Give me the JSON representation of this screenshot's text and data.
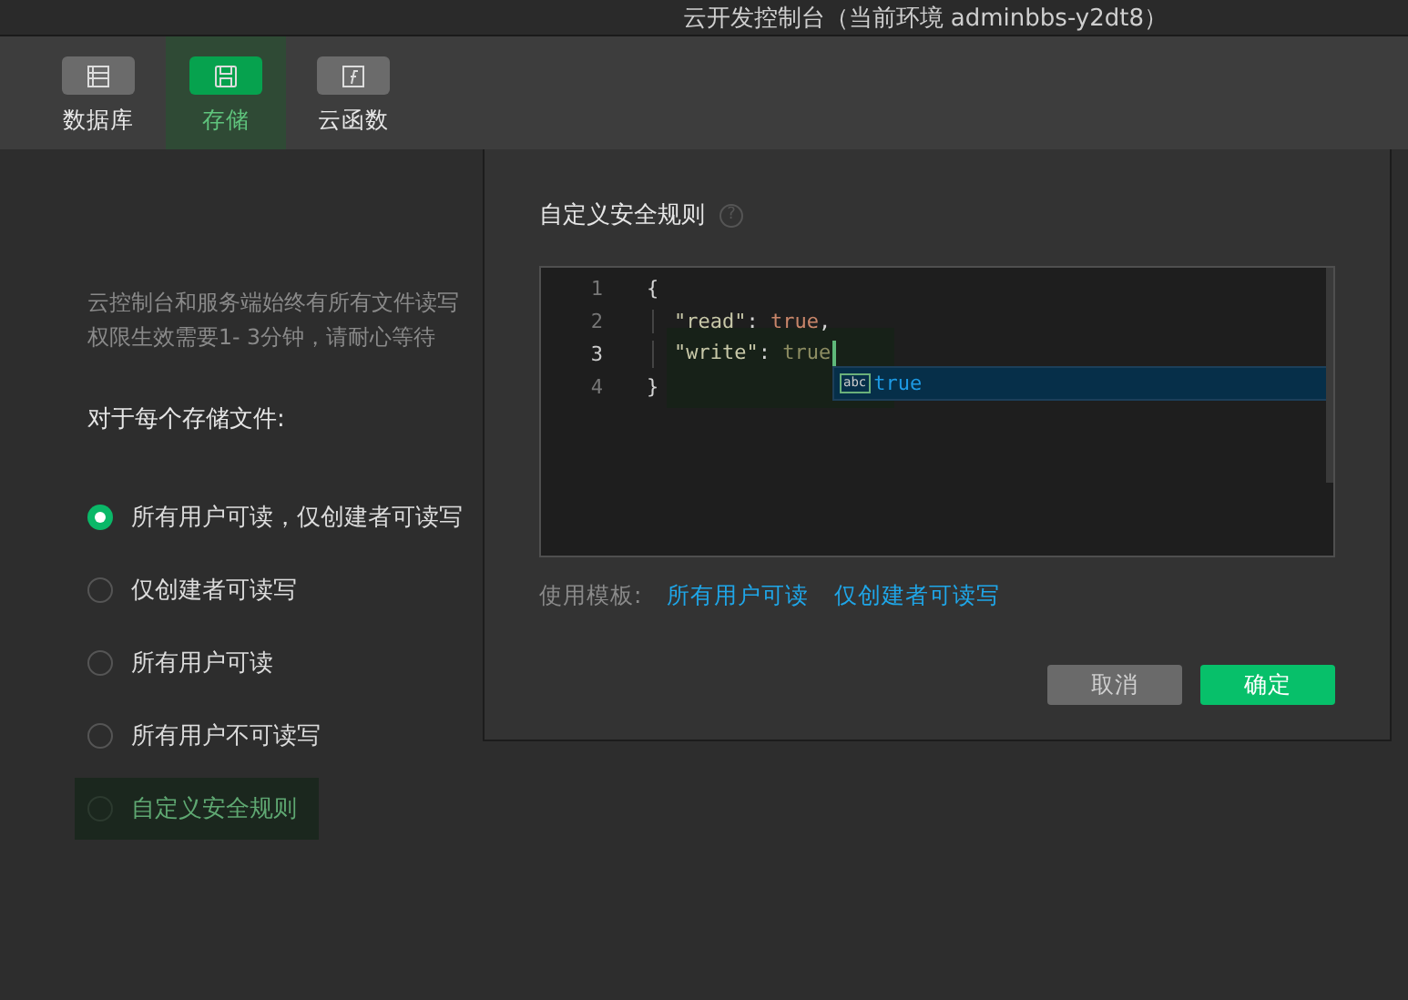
{
  "window": {
    "title": "云开发控制台（当前环境 adminbbs-y2dt8）"
  },
  "toolbar": [
    {
      "label": "数据库",
      "selected": false
    },
    {
      "label": "存储",
      "selected": true
    },
    {
      "label": "云函数",
      "selected": false
    }
  ],
  "panel": {
    "description": [
      "云控制台和服务端始终有所有文件读写",
      "权限生效需要1- 3分钟，请耐心等待"
    ],
    "heading": "对于每个存储文件:",
    "options": [
      {
        "label": "所有用户可读，仅创建者可读写",
        "selected": true,
        "highlighted": false
      },
      {
        "label": "仅创建者可读写",
        "selected": false,
        "highlighted": false
      },
      {
        "label": "所有用户可读",
        "selected": false,
        "highlighted": false
      },
      {
        "label": "所有用户不可读写",
        "selected": false,
        "highlighted": false
      },
      {
        "label": "自定义安全规则",
        "selected": false,
        "highlighted": true
      }
    ]
  },
  "dialog": {
    "title": "自定义安全规则",
    "help_icon": "?",
    "editor": {
      "lines": [
        {
          "number": "1",
          "current": false,
          "tokens": [
            {
              "kind": "punct",
              "text": "{"
            }
          ]
        },
        {
          "number": "2",
          "current": false,
          "tokens": [
            {
              "kind": "key",
              "text": "\"read\""
            },
            {
              "kind": "punct",
              "text": ": "
            },
            {
              "kind": "bool",
              "text": "true"
            },
            {
              "kind": "punct",
              "text": ","
            }
          ]
        },
        {
          "number": "3",
          "current": true,
          "tokens": [
            {
              "kind": "key",
              "text": "\"write\""
            },
            {
              "kind": "punct",
              "text": ": "
            },
            {
              "kind": "typing",
              "text": "true"
            }
          ]
        },
        {
          "number": "4",
          "current": false,
          "tokens": [
            {
              "kind": "punct",
              "text": "}"
            }
          ]
        }
      ],
      "suggestion": {
        "badge": "abc",
        "text": "true"
      }
    },
    "templates_label": "使用模板:",
    "templates": [
      "所有用户可读",
      "仅创建者可读写"
    ],
    "buttons": [
      {
        "label": "取消",
        "kind": "secondary"
      },
      {
        "label": "确定",
        "kind": "primary"
      }
    ]
  }
}
